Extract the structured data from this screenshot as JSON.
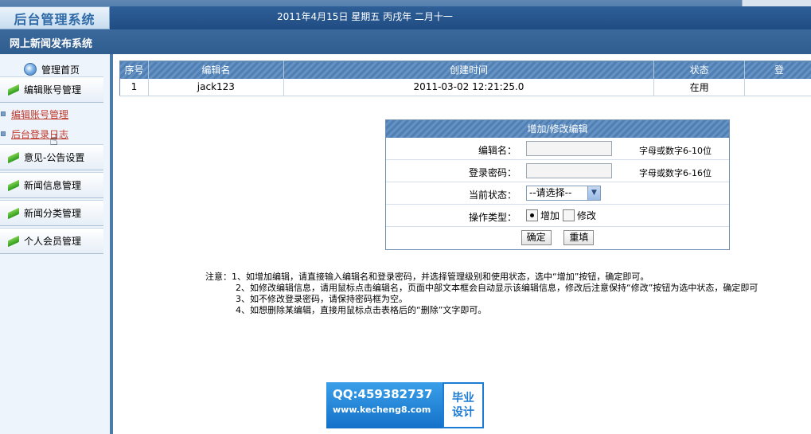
{
  "header": {
    "logo": "后台管理系统",
    "date": "2011年4月15日  星期五  丙戌年  二月十一",
    "app_title": "网上新闻发布系统"
  },
  "sidebar": {
    "home": "管理首页",
    "menu": [
      {
        "label": "编辑账号管理"
      },
      {
        "label": "意见-公告设置"
      },
      {
        "label": "新闻信息管理"
      },
      {
        "label": "新闻分类管理"
      },
      {
        "label": "个人会员管理"
      }
    ],
    "sub_items": [
      {
        "label": "编辑账号管理"
      },
      {
        "label": "后台登录日志"
      }
    ]
  },
  "table": {
    "headers": [
      "序号",
      "编辑名",
      "创建时间",
      "状态",
      "登"
    ],
    "rows": [
      [
        "1",
        "jack123",
        "2011-03-02 12:21:25.0",
        "在用",
        ""
      ]
    ]
  },
  "form": {
    "title": "增加/修改编辑",
    "editor_name_label": "编辑名：",
    "editor_name_value": "",
    "editor_name_hint": "字母或数字6-10位",
    "password_label": "登录密码：",
    "password_value": "",
    "password_hint": "字母或数字6-16位",
    "status_label": "当前状态：",
    "status_selected": "--请选择--",
    "op_label": "操作类型：",
    "op_add": "增加",
    "op_modify": "修改",
    "confirm": "确定",
    "reset": "重填"
  },
  "notes": [
    "注意：1、如增加编辑，请直接输入编辑名和登录密码，并选择管理级别和使用状态，选中“增加”按钮，确定即可。",
    "2、如修改编辑信息，请用鼠标点击编辑名，页面中部文本框会自动显示该编辑信息，修改后注意保持“修改”按钮为选中状态，确定即可",
    "3、如不修改登录密码，请保持密码框为空。",
    "4、如想删除某编辑，直接用鼠标点击表格后的“删除”文字即可。"
  ],
  "watermark": {
    "qq": "QQ:459382737",
    "site": "www.kecheng8.com",
    "badge_top": "毕业",
    "badge_bottom": "设计"
  }
}
